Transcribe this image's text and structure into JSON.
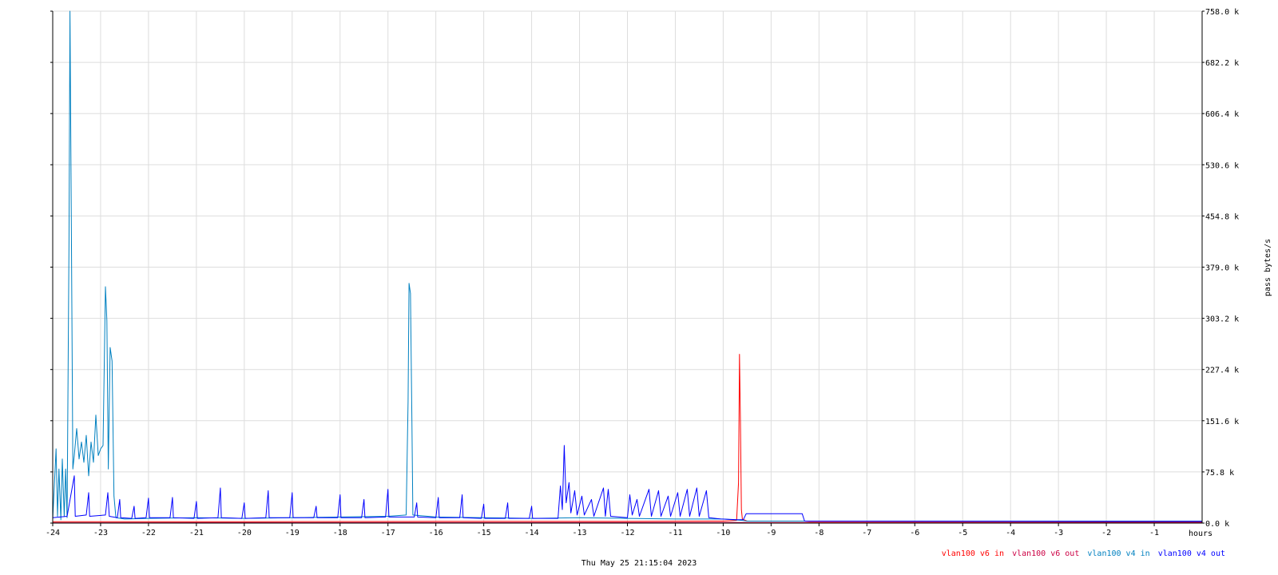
{
  "chart_data": {
    "type": "line",
    "x_unit_label": "hours",
    "ylabel": "pass bytes/s",
    "date_label": "Thu May 25 21:15:04 2023",
    "xlim": [
      -24,
      0
    ],
    "ylim": [
      0,
      758000
    ],
    "x_ticks": [
      -24,
      -23,
      -22,
      -21,
      -20,
      -19,
      -18,
      -17,
      -16,
      -15,
      -14,
      -13,
      -12,
      -11,
      -10,
      -9,
      -8,
      -7,
      -6,
      -5,
      -4,
      -3,
      -2,
      -1
    ],
    "x_tick_labels": [
      "-24",
      "-23",
      "-22",
      "-21",
      "-20",
      "-19",
      "-18",
      "-17",
      "-16",
      "-15",
      "-14",
      "-13",
      "-12",
      "-11",
      "-10",
      "-9",
      "-8",
      "-7",
      "-6",
      "-5",
      "-4",
      "-3",
      "-2",
      "-1"
    ],
    "y_ticks": [
      0,
      75800,
      151600,
      227400,
      303200,
      379000,
      454800,
      530600,
      606400,
      682200,
      758000
    ],
    "y_tick_labels": [
      "0.0 k",
      "75.8 k",
      "151.6 k",
      "227.4 k",
      "303.2 k",
      "379.0 k",
      "454.8 k",
      "530.6 k",
      "606.4 k",
      "682.2 k",
      "758.0 k"
    ],
    "grid": true,
    "legend_position": "bottom-right",
    "series": [
      {
        "name": "vlan100 v6 in",
        "color": "#ff0000",
        "points": [
          [
            -24,
            2000
          ],
          [
            -20,
            2000
          ],
          [
            -16,
            2500
          ],
          [
            -12,
            2500
          ],
          [
            -10,
            3000
          ],
          [
            -9.72,
            4000
          ],
          [
            -9.68,
            60000
          ],
          [
            -9.66,
            250000
          ],
          [
            -9.64,
            150000
          ],
          [
            -9.62,
            20000
          ],
          [
            -9.6,
            6000
          ],
          [
            -9.5,
            3000
          ],
          [
            -8.3,
            3000
          ],
          [
            -8.2,
            2500
          ],
          [
            0,
            2500
          ]
        ]
      },
      {
        "name": "vlan100 v6 out",
        "color": "#cc0044",
        "points": [
          [
            -24,
            500
          ],
          [
            -12,
            800
          ],
          [
            -9.6,
            1000
          ],
          [
            -8.3,
            1000
          ],
          [
            0,
            1200
          ]
        ]
      },
      {
        "name": "vlan100 v4 in",
        "color": "#0080c0",
        "points": [
          [
            -24,
            5000
          ],
          [
            -23.93,
            110000
          ],
          [
            -23.9,
            10000
          ],
          [
            -23.87,
            80000
          ],
          [
            -23.83,
            5000
          ],
          [
            -23.8,
            95000
          ],
          [
            -23.76,
            10000
          ],
          [
            -23.73,
            80000
          ],
          [
            -23.7,
            8000
          ],
          [
            -23.66,
            420000
          ],
          [
            -23.64,
            758000
          ],
          [
            -23.61,
            430000
          ],
          [
            -23.58,
            80000
          ],
          [
            -23.55,
            100000
          ],
          [
            -23.5,
            140000
          ],
          [
            -23.45,
            95000
          ],
          [
            -23.4,
            120000
          ],
          [
            -23.35,
            90000
          ],
          [
            -23.3,
            130000
          ],
          [
            -23.25,
            70000
          ],
          [
            -23.2,
            120000
          ],
          [
            -23.15,
            90000
          ],
          [
            -23.1,
            160000
          ],
          [
            -23.05,
            100000
          ],
          [
            -23.0,
            110000
          ],
          [
            -22.95,
            115000
          ],
          [
            -22.9,
            350000
          ],
          [
            -22.87,
            300000
          ],
          [
            -22.84,
            80000
          ],
          [
            -22.8,
            260000
          ],
          [
            -22.76,
            240000
          ],
          [
            -22.72,
            40000
          ],
          [
            -22.68,
            8000
          ],
          [
            -22.5,
            6000
          ],
          [
            -22,
            7000
          ],
          [
            -21,
            8000
          ],
          [
            -20,
            7000
          ],
          [
            -19,
            8000
          ],
          [
            -18,
            9000
          ],
          [
            -17,
            10000
          ],
          [
            -16.62,
            12000
          ],
          [
            -16.58,
            180000
          ],
          [
            -16.56,
            355000
          ],
          [
            -16.53,
            340000
          ],
          [
            -16.5,
            150000
          ],
          [
            -16.48,
            12000
          ],
          [
            -16,
            9000
          ],
          [
            -15,
            8000
          ],
          [
            -14,
            7000
          ],
          [
            -13,
            8000
          ],
          [
            -12,
            7000
          ],
          [
            -11,
            6000
          ],
          [
            -10,
            6000
          ],
          [
            -9.6,
            4000
          ],
          [
            -9.5,
            3000
          ],
          [
            -8.3,
            3000
          ],
          [
            0,
            3000
          ]
        ]
      },
      {
        "name": "vlan100 v4 out",
        "color": "#0000ff",
        "points": [
          [
            -24,
            8000
          ],
          [
            -23.7,
            10000
          ],
          [
            -23.55,
            70000
          ],
          [
            -23.53,
            10000
          ],
          [
            -23.3,
            12000
          ],
          [
            -23.25,
            45000
          ],
          [
            -23.23,
            10000
          ],
          [
            -22.9,
            12000
          ],
          [
            -22.85,
            45000
          ],
          [
            -22.82,
            10000
          ],
          [
            -22.65,
            8000
          ],
          [
            -22.6,
            35000
          ],
          [
            -22.58,
            8000
          ],
          [
            -22.35,
            7000
          ],
          [
            -22.3,
            25000
          ],
          [
            -22.28,
            7000
          ],
          [
            -22.05,
            8000
          ],
          [
            -22,
            37000
          ],
          [
            -21.98,
            8000
          ],
          [
            -21.55,
            8000
          ],
          [
            -21.5,
            38000
          ],
          [
            -21.48,
            8000
          ],
          [
            -21.05,
            7000
          ],
          [
            -21,
            32000
          ],
          [
            -20.98,
            7000
          ],
          [
            -20.55,
            8000
          ],
          [
            -20.5,
            52000
          ],
          [
            -20.48,
            8000
          ],
          [
            -20.05,
            7000
          ],
          [
            -20,
            30000
          ],
          [
            -19.98,
            7000
          ],
          [
            -19.55,
            8000
          ],
          [
            -19.5,
            48000
          ],
          [
            -19.48,
            8000
          ],
          [
            -19.05,
            8000
          ],
          [
            -19,
            45000
          ],
          [
            -18.98,
            8000
          ],
          [
            -18.55,
            8000
          ],
          [
            -18.5,
            25000
          ],
          [
            -18.48,
            8000
          ],
          [
            -18.05,
            8000
          ],
          [
            -18,
            42000
          ],
          [
            -17.98,
            8000
          ],
          [
            -17.55,
            8000
          ],
          [
            -17.5,
            35000
          ],
          [
            -17.48,
            8000
          ],
          [
            -17.05,
            9000
          ],
          [
            -17,
            50000
          ],
          [
            -16.98,
            9000
          ],
          [
            -16.45,
            9000
          ],
          [
            -16.4,
            30000
          ],
          [
            -16.38,
            9000
          ],
          [
            -16,
            8000
          ],
          [
            -15.95,
            38000
          ],
          [
            -15.93,
            8000
          ],
          [
            -15.5,
            8000
          ],
          [
            -15.45,
            42000
          ],
          [
            -15.43,
            8000
          ],
          [
            -15.05,
            7000
          ],
          [
            -15,
            28000
          ],
          [
            -14.98,
            7000
          ],
          [
            -14.55,
            7000
          ],
          [
            -14.5,
            30000
          ],
          [
            -14.48,
            7000
          ],
          [
            -14.05,
            7000
          ],
          [
            -14,
            25000
          ],
          [
            -13.98,
            7000
          ],
          [
            -13.45,
            7000
          ],
          [
            -13.4,
            55000
          ],
          [
            -13.36,
            20000
          ],
          [
            -13.32,
            115000
          ],
          [
            -13.28,
            30000
          ],
          [
            -13.22,
            60000
          ],
          [
            -13.18,
            15000
          ],
          [
            -13.1,
            48000
          ],
          [
            -13.05,
            12000
          ],
          [
            -12.95,
            40000
          ],
          [
            -12.9,
            12000
          ],
          [
            -12.75,
            35000
          ],
          [
            -12.7,
            10000
          ],
          [
            -12.5,
            52000
          ],
          [
            -12.46,
            10000
          ],
          [
            -12.4,
            50000
          ],
          [
            -12.35,
            10000
          ],
          [
            -12,
            8000
          ],
          [
            -11.95,
            42000
          ],
          [
            -11.9,
            12000
          ],
          [
            -11.8,
            35000
          ],
          [
            -11.75,
            10000
          ],
          [
            -11.55,
            50000
          ],
          [
            -11.5,
            10000
          ],
          [
            -11.35,
            48000
          ],
          [
            -11.3,
            10000
          ],
          [
            -11.15,
            40000
          ],
          [
            -11.1,
            10000
          ],
          [
            -10.95,
            45000
          ],
          [
            -10.9,
            10000
          ],
          [
            -10.75,
            50000
          ],
          [
            -10.7,
            10000
          ],
          [
            -10.55,
            52000
          ],
          [
            -10.5,
            10000
          ],
          [
            -10.35,
            48000
          ],
          [
            -10.3,
            8000
          ],
          [
            -10.05,
            6000
          ],
          [
            -9.7,
            5000
          ],
          [
            -9.58,
            5000
          ],
          [
            -9.52,
            14000
          ],
          [
            -8.35,
            14000
          ],
          [
            -8.3,
            3000
          ],
          [
            0,
            2500
          ]
        ]
      }
    ]
  }
}
